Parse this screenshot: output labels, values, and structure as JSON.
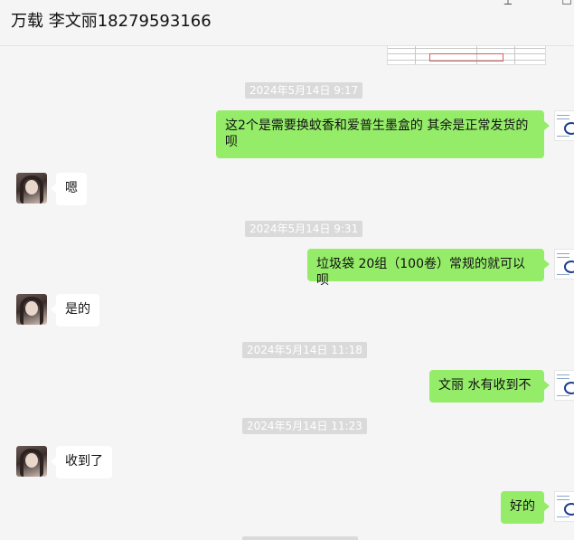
{
  "window": {
    "title": "万载 李文丽18279593166",
    "controls": {
      "pin": "⟂",
      "minimize": "—",
      "maximize": "☐"
    }
  },
  "messages": [
    {
      "type": "image_preview",
      "sender": "me"
    },
    {
      "type": "timestamp",
      "text": "2024年5月14日 9:17"
    },
    {
      "type": "text",
      "sender": "me",
      "text": "这2个是需要换蚊香和爱普生墨盒的    其余是正常发货的呗"
    },
    {
      "type": "text",
      "sender": "them",
      "text": "嗯"
    },
    {
      "type": "timestamp",
      "text": "2024年5月14日 9:31"
    },
    {
      "type": "text",
      "sender": "me",
      "text": "垃圾袋 20组（100卷）常规的就可以呗"
    },
    {
      "type": "text",
      "sender": "them",
      "text": "是的"
    },
    {
      "type": "timestamp",
      "text": "2024年5月14日 11:18"
    },
    {
      "type": "text",
      "sender": "me",
      "text": "文丽  水有收到不"
    },
    {
      "type": "timestamp",
      "text": "2024年5月14日 11:23"
    },
    {
      "type": "text",
      "sender": "them",
      "text": "收到了"
    },
    {
      "type": "text",
      "sender": "me",
      "text": "好的"
    }
  ],
  "colors": {
    "background": "#f5f5f5",
    "bubble_me": "#95ec69",
    "bubble_them": "#ffffff",
    "timestamp_bg": "#dadada"
  },
  "icons": {
    "pin": "pin-icon",
    "minimize": "minimize-icon",
    "maximize": "maximize-icon"
  }
}
